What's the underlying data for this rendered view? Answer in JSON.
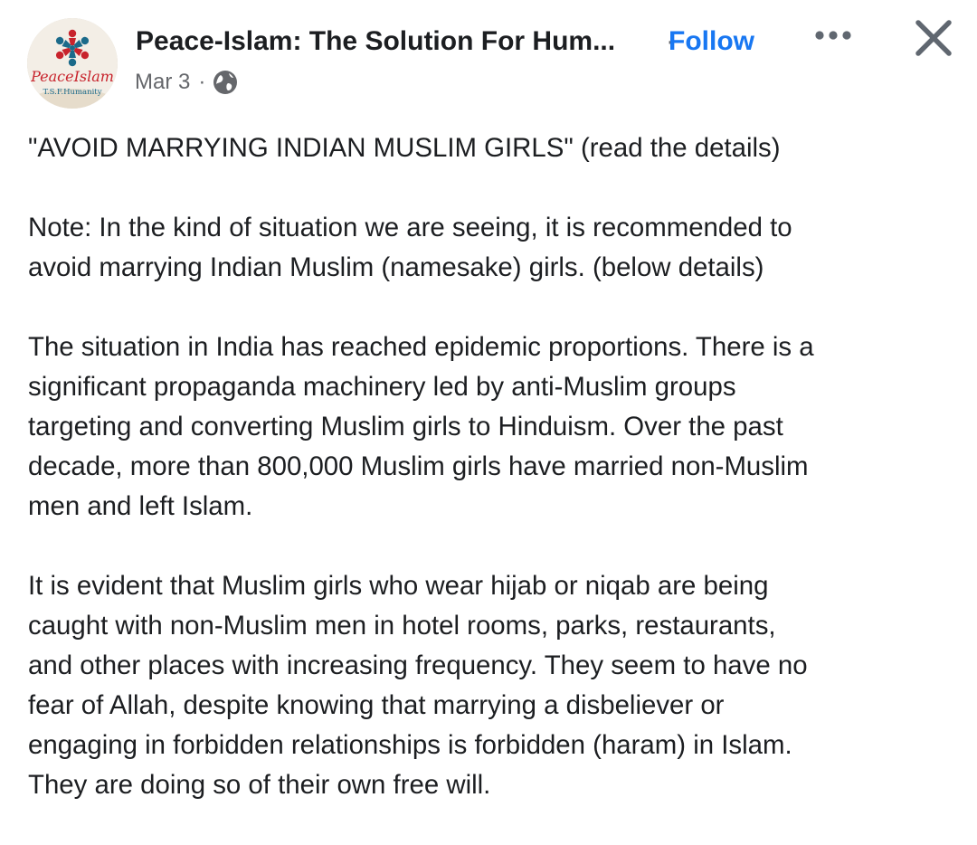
{
  "post": {
    "page_name": "Peace-Islam: The Solution For Hum...",
    "follow_separator": "·",
    "follow_label": "Follow",
    "date": "Mar 3",
    "date_separator": "·",
    "privacy_icon": "globe-icon",
    "more_icon": "more-options-icon",
    "close_icon": "close-icon",
    "avatar": {
      "logo_text": "PeaceIslam",
      "logo_subtext": "T.S.F.Humanity"
    },
    "paragraphs": [
      "\"AVOID MARRYING INDIAN MUSLIM GIRLS\" (read the details)",
      "Note: In the kind of situation we are seeing, it is recommended to\navoid marrying Indian Muslim (namesake) girls. (below details)",
      "The situation in India has reached epidemic proportions. There is a\nsignificant propaganda machinery led by anti-Muslim groups\ntargeting and converting Muslim girls to Hinduism. Over the past\ndecade, more than 800,000 Muslim girls have married non-Muslim\nmen and left Islam.",
      "It is evident that Muslim girls who wear hijab or niqab are being\ncaught with non-Muslim men in hotel rooms, parks, restaurants,\nand other places with increasing frequency. They seem to have no\nfear of Allah, despite knowing that marrying a disbeliever or\nengaging in forbidden relationships is forbidden (haram) in Islam.\nThey are doing so of their own free will."
    ]
  },
  "colors": {
    "text": "#1c1e21",
    "secondary_text": "#65676b",
    "follow_blue": "#1877f2",
    "icon_gray": "#606770",
    "logo_red": "#c8232c",
    "logo_teal": "#1b6a8a"
  }
}
